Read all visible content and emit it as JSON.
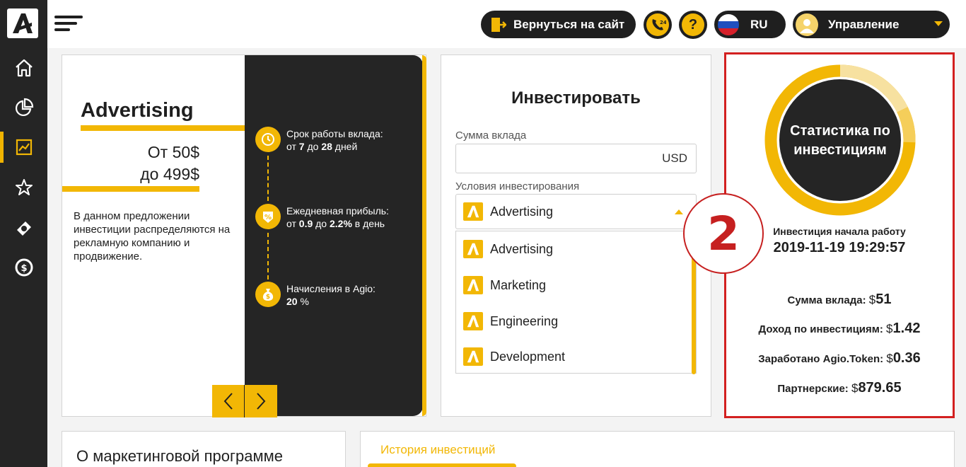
{
  "topbar": {
    "back_to_site_label": "Вернуться на сайт",
    "language_label": "RU",
    "manage_label": "Управление"
  },
  "colors": {
    "accent": "#f2b705",
    "dark": "#252525",
    "highlight": "#d32020"
  },
  "offer": {
    "title": "Advertising",
    "price_from": "От 50$",
    "price_to": "до 499$",
    "description": "В данном предложении инвестиции распределяются на рекламную компанию и продвижение.",
    "features": [
      {
        "icon": "clock-icon",
        "label": "Срок работы вклада:",
        "p1": "от ",
        "v1": "7",
        "p2": " до ",
        "v2": "28",
        "p3": " дней"
      },
      {
        "icon": "percent-icon",
        "label": "Ежедневная прибыль:",
        "p1": "от ",
        "v1": "0.9",
        "p2": " до ",
        "v2": "2.2%",
        "p3": " в день"
      },
      {
        "icon": "money-bag-icon",
        "label": "Начисления в Agio:",
        "p1": "",
        "v1": "20",
        "p2": " %",
        "v2": "",
        "p3": ""
      }
    ]
  },
  "invest": {
    "title": "Инвестировать",
    "amount_label": "Сумма вклада",
    "currency": "USD",
    "conditions_label": "Условия инвестирования",
    "selected": "Advertising",
    "options": [
      "Advertising",
      "Marketing",
      "Engineering",
      "Development"
    ]
  },
  "stats": {
    "ring_title": "Статистика по инвестициям",
    "started_label": "Инвестиция начала работу",
    "started_value": "2019-11-19 19:29:57",
    "rows": [
      {
        "label": "Сумма вклада:",
        "currency": "$",
        "value": "51"
      },
      {
        "label": "Доход по инвестициям:",
        "currency": "$",
        "value": "1.42"
      },
      {
        "label": "Заработано Agio.Token:",
        "currency": "$",
        "value": "0.36"
      },
      {
        "label": "Партнерские:",
        "currency": "$",
        "value": "879.65"
      }
    ]
  },
  "annotation_badge": "2",
  "bottom": {
    "marketing_title": "О маркетинговой программе",
    "history_tab": "История инвестиций"
  }
}
